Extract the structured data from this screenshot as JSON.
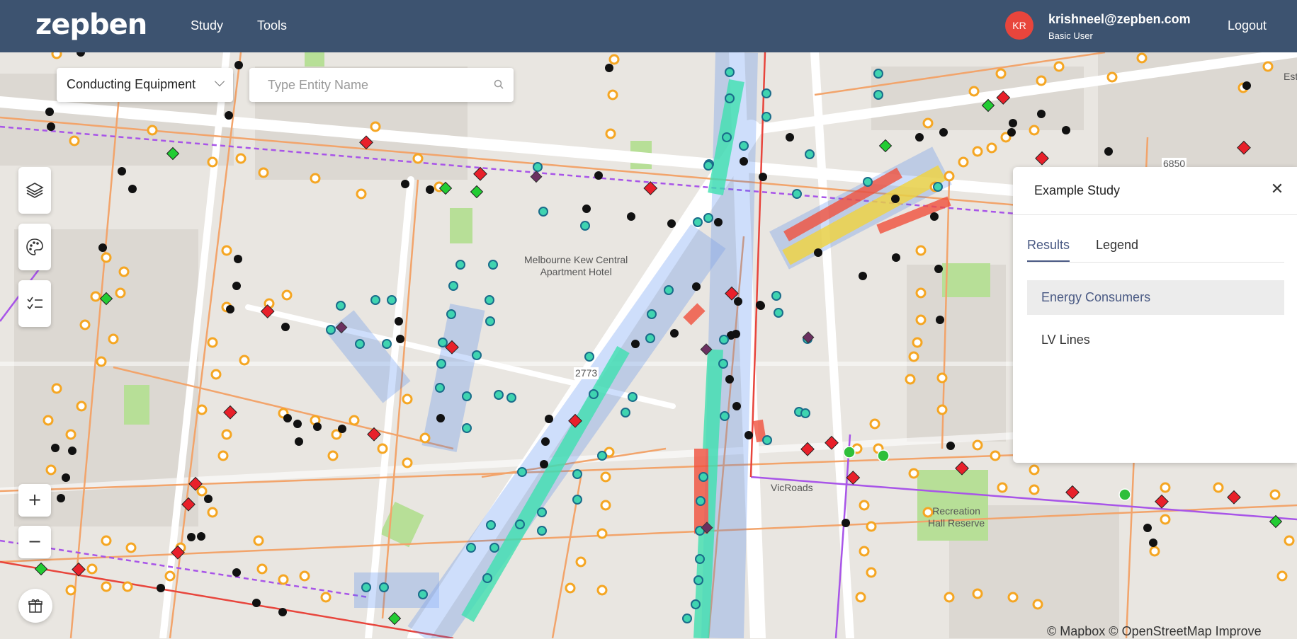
{
  "header": {
    "logo": "zepben",
    "nav": [
      {
        "label": "Study"
      },
      {
        "label": "Tools"
      }
    ],
    "user": {
      "initials": "KR",
      "email": "krishneel@zepben.com",
      "role": "Basic User"
    },
    "logout_label": "Logout"
  },
  "toolbar": {
    "entity_type": "Conducting Equipment",
    "search_placeholder": "Type Entity Name",
    "search_value": ""
  },
  "map_labels": {
    "hotel": "Melbourne Kew Central\nApartment Hotel",
    "vicroads": "VicRoads",
    "reserve": "Recreation\nHall Reserve",
    "num_2773": "2773",
    "num_6850": "6850",
    "corner": "Est"
  },
  "attribution": "© Mapbox © OpenStreetMap  Improve",
  "study_panel": {
    "title": "Example Study",
    "tabs": [
      {
        "label": "Results",
        "active": true
      },
      {
        "label": "Legend",
        "active": false
      }
    ],
    "results": [
      {
        "label": "Energy Consumers",
        "active": true
      },
      {
        "label": "LV Lines",
        "active": false
      }
    ]
  },
  "colors": {
    "header_bg": "#3d5370",
    "avatar": "#e8453c",
    "accent": "#4a5a84",
    "map_bg": "#e9e6e1",
    "lv_line": "#f2a46b",
    "hv_line": "#a855e8",
    "consumer": "#f5a623"
  },
  "icons": {
    "layers": "layers-icon",
    "palette": "palette-icon",
    "checklist": "checklist-icon",
    "zoom_in": "plus-icon",
    "zoom_out": "minus-icon",
    "gift": "gift-icon",
    "search": "search-icon",
    "close": "close-icon"
  }
}
